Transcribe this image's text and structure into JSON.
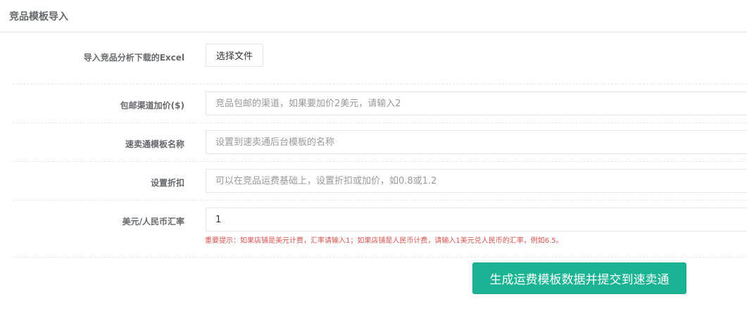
{
  "panel": {
    "title": "竞品模板导入"
  },
  "form": {
    "excel": {
      "label": "导入竞品分析下载的Excel",
      "button_label": "选择文件"
    },
    "shipping_markup": {
      "label": "包邮渠道加价($)",
      "placeholder": "竞品包邮的渠道，如果要加价2美元，请输入2",
      "value": ""
    },
    "template_name": {
      "label": "速卖通模板名称",
      "placeholder": "设置到速卖通后台模板的名称",
      "value": ""
    },
    "discount": {
      "label": "设置折扣",
      "placeholder": "可以在竞品运费基础上，设置折扣或加价，如0.8或1.2",
      "value": ""
    },
    "exchange_rate": {
      "label": "美元/人民币汇率",
      "value": "1",
      "hint": "重要提示：如果店铺是美元计费，汇率请输入1；如果店铺是人民币计费，请输入1美元兑人民币的汇率，例如6.5。"
    },
    "submit_label": "生成运费模板数据并提交到速卖通"
  },
  "colors": {
    "primary": "#1ab394",
    "hint": "#d9534f",
    "label": "#676a6c",
    "border": "#e5e6e7"
  }
}
